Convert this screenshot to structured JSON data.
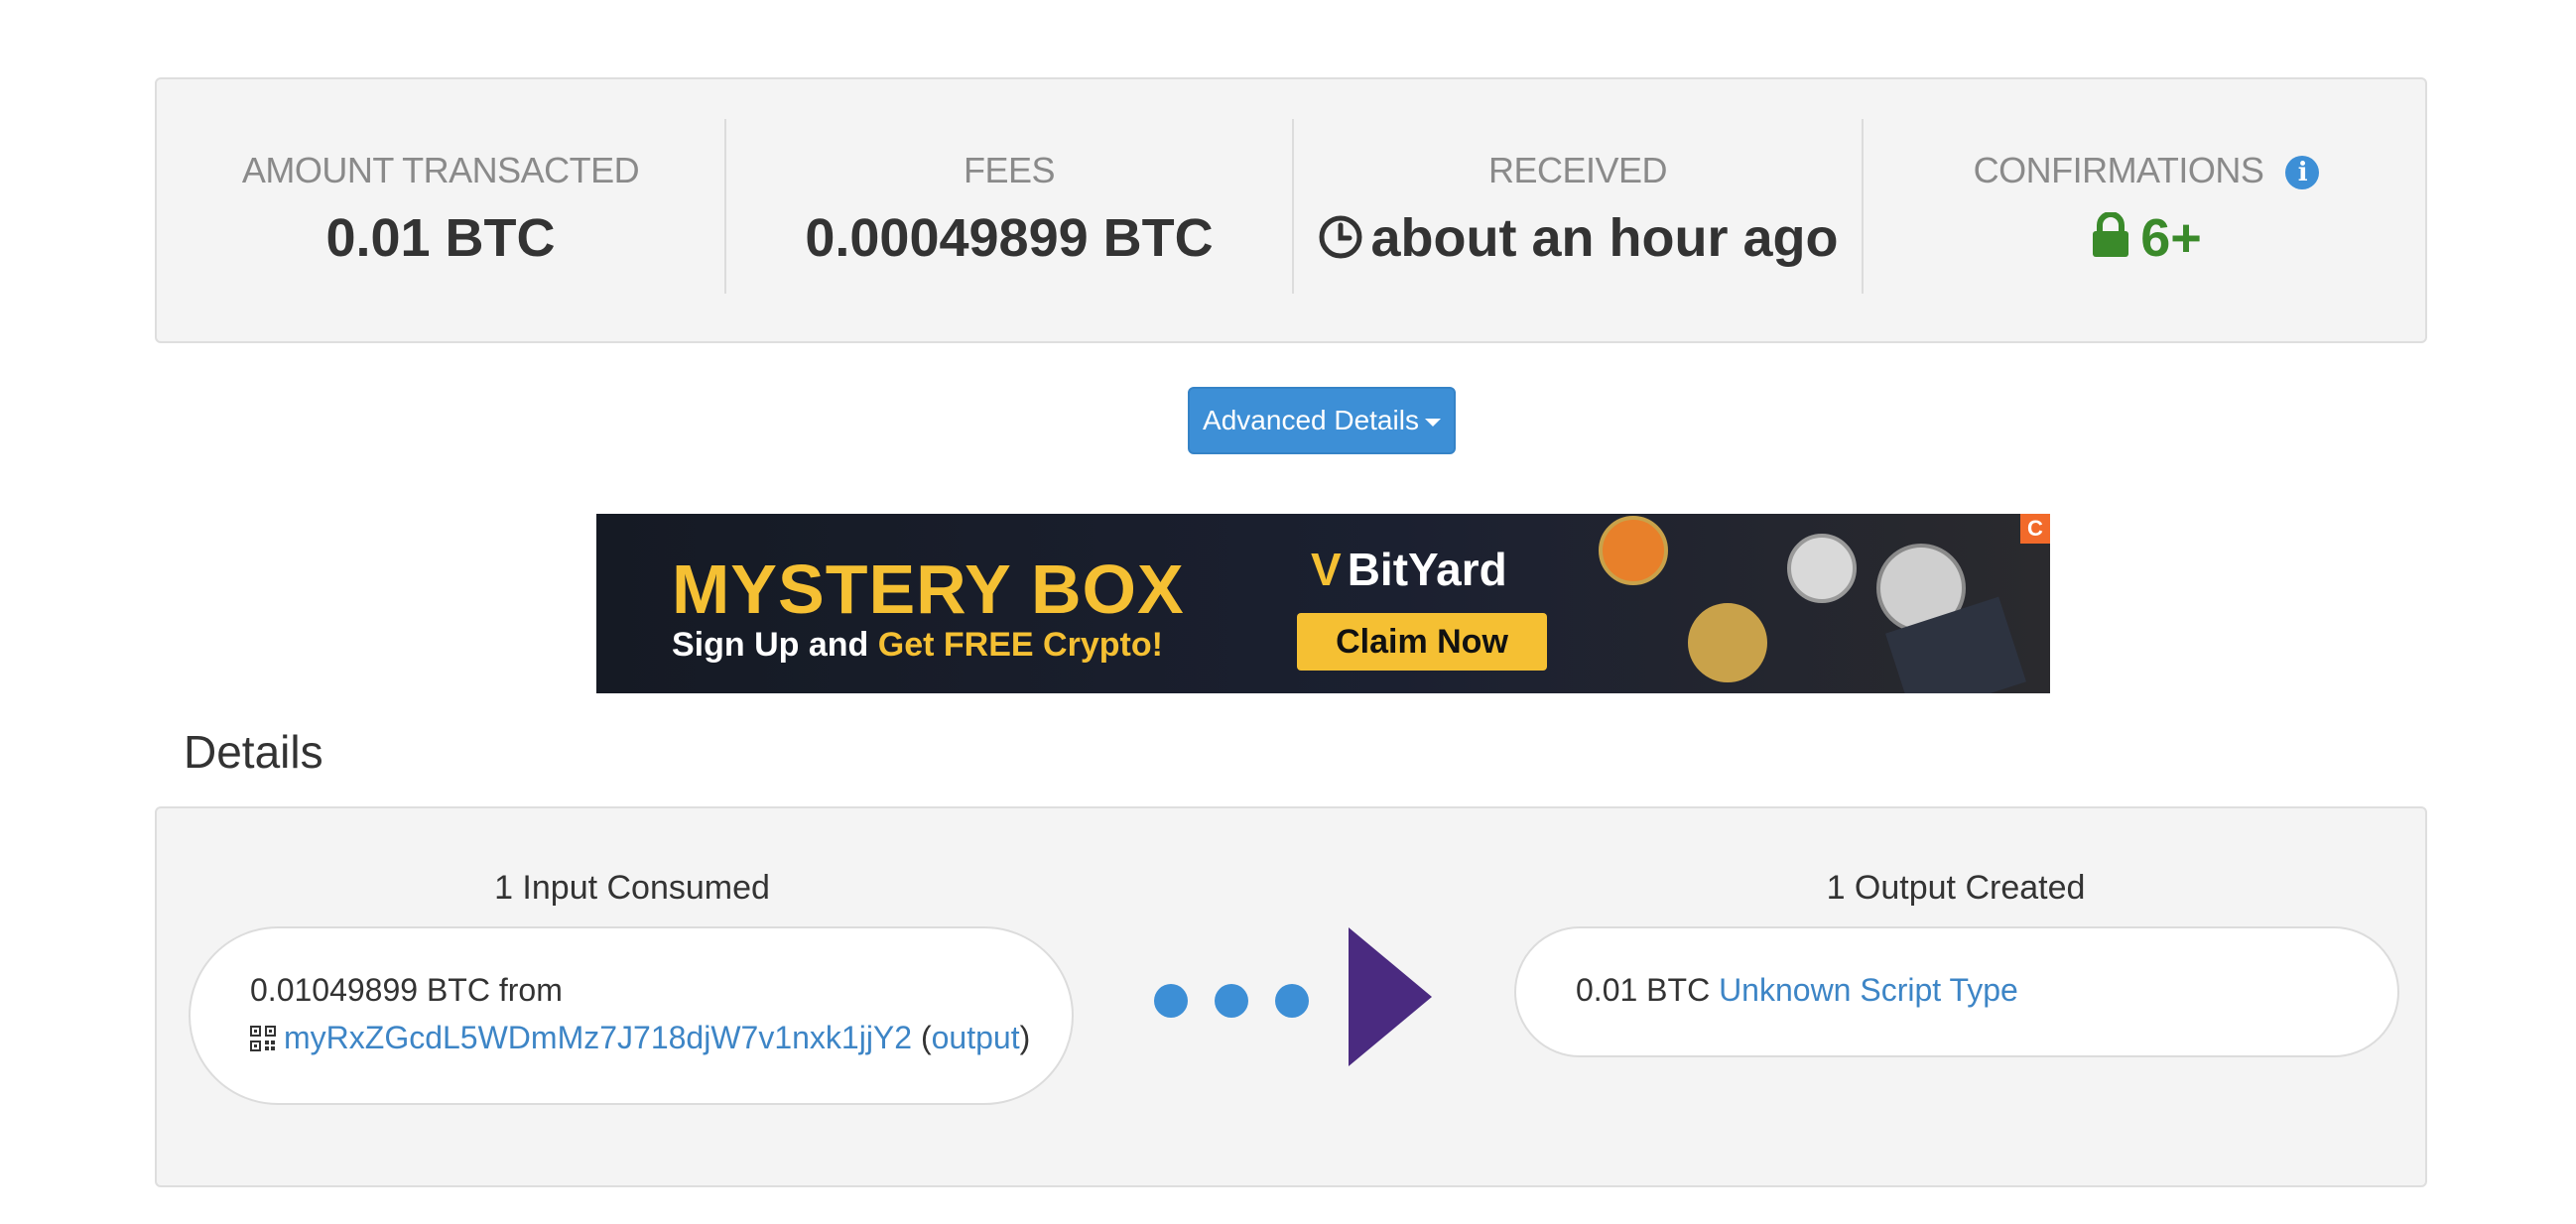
{
  "summary": {
    "amount_label": "AMOUNT TRANSACTED",
    "amount_value": "0.01 BTC",
    "fees_label": "FEES",
    "fees_value": "0.00049899 BTC",
    "received_label": "RECEIVED",
    "received_value": "about an hour ago",
    "confirmations_label": "CONFIRMATIONS",
    "confirmations_value": "6+"
  },
  "advanced_button": {
    "label": "Advanced Details"
  },
  "ad": {
    "headline": "MYSTERY BOX",
    "sub_prefix": "Sign Up and ",
    "sub_highlight": "Get FREE Crypto!",
    "brand": "BitYard",
    "cta": "Claim Now",
    "corner": "C"
  },
  "details": {
    "title": "Details",
    "inputs_heading": "1 Input Consumed",
    "outputs_heading": "1 Output Created",
    "input": {
      "amount": "0.01049899 BTC",
      "from_word": "from",
      "address": "myRxZGcdL5WDmMz7J718djW7v1nxk1jjY2",
      "output_link": "output"
    },
    "output": {
      "amount": "0.01 BTC",
      "script_type": "Unknown Script Type"
    }
  },
  "colors": {
    "accent": "#3d8fd6",
    "confirmed": "#3a8a2a",
    "arrow": "#4a2a80",
    "ad_yellow": "#f5c033"
  }
}
